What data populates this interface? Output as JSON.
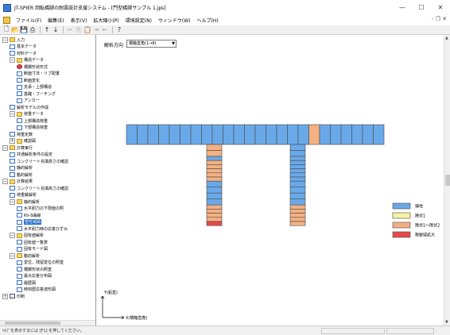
{
  "window": {
    "title": "JT-SPIER 回転橋脚の耐震設計支援システム - [門型橋脚サンプル 1.jps]",
    "minimize": "—",
    "maximize": "☐",
    "close": "✕"
  },
  "menu": {
    "items": [
      "ファイル(F)",
      "編集(E)",
      "表示(V)",
      "拡大縮小(P)",
      "環境設定(N)",
      "ウィンドウ(W)",
      "ヘルプ(H)"
    ],
    "right": "- ❐ ✕"
  },
  "toolbar": {
    "buttons": [
      {
        "icon": "new-file-icon",
        "glyph": "🗋",
        "enabled": true
      },
      {
        "icon": "open-folder-icon",
        "glyph": "📂",
        "enabled": true
      },
      {
        "icon": "save-icon",
        "glyph": "💾",
        "enabled": true
      },
      {
        "icon": "print-icon",
        "glyph": "⎙",
        "enabled": true
      },
      {
        "icon": "arrow-up-icon",
        "glyph": "↑",
        "enabled": true
      },
      {
        "icon": "arrow-down-icon",
        "glyph": "↓",
        "enabled": true
      },
      {
        "icon": "cut-icon",
        "glyph": "✂",
        "enabled": false
      },
      {
        "icon": "copy-icon",
        "glyph": "⎘",
        "enabled": false
      },
      {
        "icon": "paste-icon",
        "glyph": "📋",
        "enabled": false
      },
      {
        "icon": "insert-icon",
        "glyph": "⇥",
        "enabled": false
      },
      {
        "icon": "delete-icon",
        "glyph": "⇤",
        "enabled": false
      },
      {
        "icon": "help-icon",
        "glyph": "?",
        "enabled": true
      }
    ]
  },
  "tree": {
    "items": [
      {
        "label": "入力",
        "indent": 0,
        "exp": "−",
        "icon": "folder"
      },
      {
        "label": "基本データ",
        "indent": 1,
        "icon": "doc"
      },
      {
        "label": "材料データ",
        "indent": 1,
        "icon": "doc"
      },
      {
        "label": "構造データ",
        "indent": 1,
        "exp": "−",
        "icon": "folder"
      },
      {
        "label": "橋脚形状形式",
        "indent": 2,
        "icon": "warn"
      },
      {
        "label": "断面寸法・リブ配置",
        "indent": 2,
        "icon": "doc"
      },
      {
        "label": "断面変化",
        "indent": 2,
        "icon": "doc"
      },
      {
        "label": "支承・上部構造",
        "indent": 2,
        "icon": "doc"
      },
      {
        "label": "基礎・フーチング",
        "indent": 2,
        "icon": "doc"
      },
      {
        "label": "アンカー",
        "indent": 2,
        "icon": "doc"
      },
      {
        "label": "解析モデルの作成",
        "indent": 1,
        "icon": "doc"
      },
      {
        "label": "荷重データ",
        "indent": 1,
        "exp": "−",
        "icon": "folder"
      },
      {
        "label": "上部構造荷重",
        "indent": 2,
        "icon": "doc"
      },
      {
        "label": "下部構造荷重",
        "indent": 2,
        "icon": "doc"
      },
      {
        "label": "荷重定数",
        "indent": 1,
        "icon": "doc"
      },
      {
        "label": "確認図",
        "indent": 1,
        "exp": "+",
        "icon": "folder"
      },
      {
        "label": "計算実行",
        "indent": 0,
        "exp": "−",
        "icon": "folder"
      },
      {
        "label": "共通解析条件の設定",
        "indent": 1,
        "icon": "doc"
      },
      {
        "label": "コンクリート充填高さの確認",
        "indent": 1,
        "icon": "doc"
      },
      {
        "label": "静的解析",
        "indent": 1,
        "icon": "doc"
      },
      {
        "label": "動的解析",
        "indent": 1,
        "icon": "doc"
      },
      {
        "label": "計算結果",
        "indent": 0,
        "exp": "−",
        "icon": "folder"
      },
      {
        "label": "コンクリート充填高さの確認",
        "indent": 1,
        "icon": "doc"
      },
      {
        "label": "荷重載解析",
        "indent": 1,
        "icon": "doc"
      },
      {
        "label": "静的解析",
        "indent": 1,
        "exp": "−",
        "icon": "folder"
      },
      {
        "label": "水平耐力の下限値の照",
        "indent": 2,
        "icon": "doc"
      },
      {
        "label": "Kh-δ曲線",
        "indent": 2,
        "icon": "doc"
      },
      {
        "label": "塑性域図",
        "indent": 2,
        "icon": "doc",
        "selected": true
      },
      {
        "label": "水平耐力時の応答ひずみ",
        "indent": 2,
        "icon": "doc"
      },
      {
        "label": "固有値解析",
        "indent": 1,
        "exp": "−",
        "icon": "folder"
      },
      {
        "label": "固有値一覧表",
        "indent": 2,
        "icon": "doc"
      },
      {
        "label": "固有モード図",
        "indent": 2,
        "icon": "doc"
      },
      {
        "label": "動的解析",
        "indent": 1,
        "exp": "−",
        "icon": "folder"
      },
      {
        "label": "変位、残留変位の照査",
        "indent": 2,
        "icon": "doc"
      },
      {
        "label": "橋脚形状の照査",
        "indent": 2,
        "icon": "doc"
      },
      {
        "label": "最大応答分布図",
        "indent": 2,
        "icon": "doc"
      },
      {
        "label": "履歴図",
        "indent": 2,
        "icon": "doc"
      },
      {
        "label": "時刻歴応答波形図",
        "indent": 2,
        "icon": "doc"
      },
      {
        "label": "印刷",
        "indent": 0,
        "exp": "+",
        "icon": "grid"
      }
    ]
  },
  "content": {
    "direction_label": "解析方向",
    "direction_value": "橋軸直角(1→8)",
    "axis_y_label": "Y(鉛直)",
    "axis_x_label": "X(橋軸直角)",
    "legend": [
      {
        "label": "弾性",
        "color": "#6aa9e9"
      },
      {
        "label": "降伏1",
        "color": "#f7f3a3"
      },
      {
        "label": "降伏1～降伏2",
        "color": "#f4b183"
      },
      {
        "label": "剛塑域拡大",
        "color": "#e84a4a"
      }
    ],
    "beam": {
      "segments": 24,
      "highlight_index": 17,
      "elastic_color": "#6aa9e9",
      "highlight_color": "#f4b183"
    },
    "left_column": [
      "#f4b183",
      "#f4b183",
      "#6aa9e9",
      "#f4b183",
      "#f4b183",
      "#f4b183",
      "#f4b183",
      "#f4b183",
      "#6aa9e9",
      "#6aa9e9",
      "#6aa9e9",
      "#6aa9e9",
      "#f4b183",
      "#f4b183",
      "#f4b183",
      "#f4b183",
      "#e84a4a"
    ],
    "right_column": [
      "#6aa9e9",
      "#6aa9e9",
      "#6aa9e9",
      "#6aa9e9",
      "#6aa9e9",
      "#6aa9e9",
      "#6aa9e9",
      "#6aa9e9",
      "#6aa9e9",
      "#6aa9e9",
      "#6aa9e9",
      "#6aa9e9",
      "#f4b183",
      "#f4b183",
      "#f4b183",
      "#f4b183",
      "#f4b183"
    ]
  },
  "status": {
    "text": "ﾍﾙﾌﾟを表示するには [F1] を押してください。"
  }
}
